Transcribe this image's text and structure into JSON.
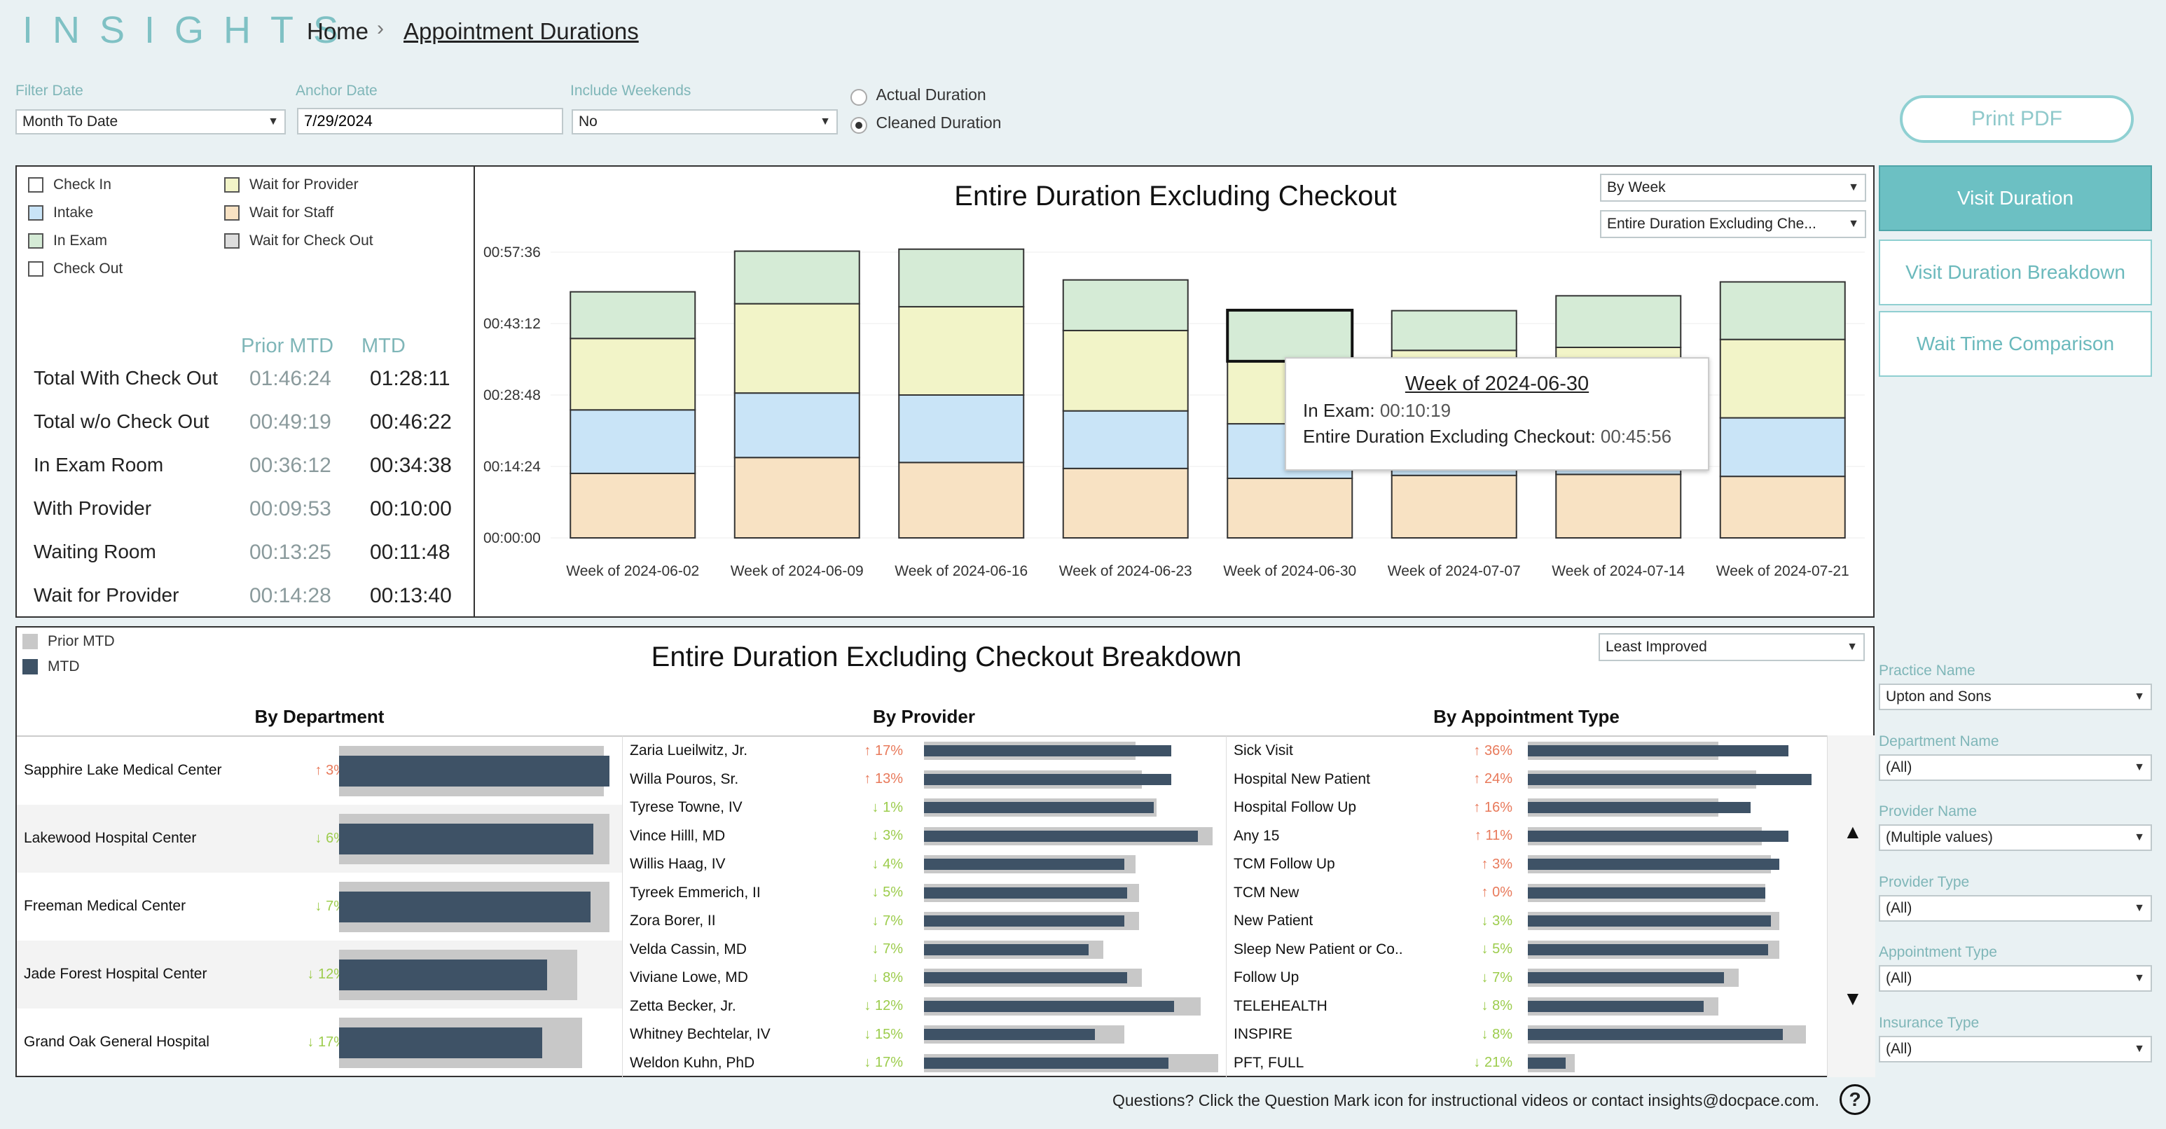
{
  "header": {
    "logo": "INSIGHTS",
    "breadcrumb": {
      "home": "Home",
      "separator": "›",
      "current": "Appointment Durations"
    }
  },
  "filters": {
    "filter_date": {
      "label": "Filter Date",
      "value": "Month To Date"
    },
    "anchor_date": {
      "label": "Anchor Date",
      "value": "7/29/2024"
    },
    "include_weekends": {
      "label": "Include Weekends",
      "value": "No"
    },
    "duration_mode": {
      "options": [
        "Actual Duration",
        "Cleaned Duration"
      ],
      "selected": "Cleaned Duration"
    }
  },
  "buttons": {
    "print": "Print PDF",
    "nav": [
      "Visit Duration",
      "Visit Duration Breakdown",
      "Wait Time Comparison"
    ],
    "active_nav": "Visit Duration"
  },
  "legend": {
    "items": [
      {
        "label": "Check In",
        "color": "#ffffff"
      },
      {
        "label": "Wait for Provider",
        "color": "#f2f4c8"
      },
      {
        "label": "Intake",
        "color": "#c9e4f7"
      },
      {
        "label": "Wait for Staff",
        "color": "#f8e2c3"
      },
      {
        "label": "In Exam",
        "color": "#d5ebd6"
      },
      {
        "label": "Wait for Check Out",
        "color": "#dddddd"
      },
      {
        "label": "Check Out",
        "color": "#ffffff"
      }
    ]
  },
  "stats": {
    "col_prior": "Prior MTD",
    "col_mtd": "MTD",
    "rows": [
      {
        "label": "Total With Check Out",
        "prior": "01:46:24",
        "mtd": "01:28:11"
      },
      {
        "label": "Total w/o Check Out",
        "prior": "00:49:19",
        "mtd": "00:46:22"
      },
      {
        "label": "In Exam Room",
        "prior": "00:36:12",
        "mtd": "00:34:38"
      },
      {
        "label": "With Provider",
        "prior": "00:09:53",
        "mtd": "00:10:00"
      },
      {
        "label": "Waiting Room",
        "prior": "00:13:25",
        "mtd": "00:11:48"
      },
      {
        "label": "Wait for Provider",
        "prior": "00:14:28",
        "mtd": "00:13:40"
      }
    ]
  },
  "main_chart": {
    "title": "Entire Duration Excluding Checkout",
    "granularity": "By Week",
    "measure": "Entire Duration Excluding Che...",
    "tooltip": {
      "title": "Week of 2024-06-30",
      "line1_label": "In Exam:",
      "line1_value": "00:10:19",
      "line2_label": "Entire Duration Excluding Checkout:",
      "line2_value": "00:45:56"
    }
  },
  "breakdown": {
    "title": "Entire Duration Excluding Checkout Breakdown",
    "sort": "Least Improved",
    "legend": [
      {
        "label": "Prior MTD",
        "color": "#c8c8c8"
      },
      {
        "label": "MTD",
        "color": "#3e5266"
      }
    ],
    "by_department": {
      "title": "By Department",
      "rows": [
        {
          "name": "Sapphire Lake Medical Center",
          "pct": "↑ 3%",
          "dir": "up",
          "prior": 0.98,
          "mtd": 1.0
        },
        {
          "name": "Lakewood Hospital Center",
          "pct": "↓ 6%",
          "dir": "down",
          "prior": 1.0,
          "mtd": 0.94
        },
        {
          "name": "Freeman Medical Center",
          "pct": "↓ 7%",
          "dir": "down",
          "prior": 1.0,
          "mtd": 0.93
        },
        {
          "name": "Jade Forest Hospital Center",
          "pct": "↓ 12%",
          "dir": "down",
          "prior": 0.88,
          "mtd": 0.77
        },
        {
          "name": "Grand Oak General Hospital",
          "pct": "↓ 17%",
          "dir": "down",
          "prior": 0.9,
          "mtd": 0.75
        }
      ]
    },
    "by_provider": {
      "title": "By Provider",
      "rows": [
        {
          "name": "Zaria Lueilwitz, Jr.",
          "pct": "↑ 17%",
          "dir": "up",
          "prior": 0.72,
          "mtd": 0.84
        },
        {
          "name": "Willa Pouros, Sr.",
          "pct": "↑ 13%",
          "dir": "up",
          "prior": 0.74,
          "mtd": 0.84
        },
        {
          "name": "Tyrese Towne, IV",
          "pct": "↓ 1%",
          "dir": "down",
          "prior": 0.79,
          "mtd": 0.78
        },
        {
          "name": "Vince Hilll, MD",
          "pct": "↓ 3%",
          "dir": "down",
          "prior": 0.98,
          "mtd": 0.93
        },
        {
          "name": "Willis Haag, IV",
          "pct": "↓ 4%",
          "dir": "down",
          "prior": 0.72,
          "mtd": 0.68
        },
        {
          "name": "Tyreek Emmerich, II",
          "pct": "↓ 5%",
          "dir": "down",
          "prior": 0.73,
          "mtd": 0.69
        },
        {
          "name": "Zora Borer, II",
          "pct": "↓ 7%",
          "dir": "down",
          "prior": 0.73,
          "mtd": 0.68
        },
        {
          "name": "Velda Cassin, MD",
          "pct": "↓ 7%",
          "dir": "down",
          "prior": 0.61,
          "mtd": 0.56
        },
        {
          "name": "Viviane Lowe, MD",
          "pct": "↓ 8%",
          "dir": "down",
          "prior": 0.74,
          "mtd": 0.69
        },
        {
          "name": "Zetta Becker, Jr.",
          "pct": "↓ 12%",
          "dir": "down",
          "prior": 0.94,
          "mtd": 0.85
        },
        {
          "name": "Whitney Bechtelar, IV",
          "pct": "↓ 15%",
          "dir": "down",
          "prior": 0.68,
          "mtd": 0.58
        },
        {
          "name": "Weldon Kuhn, PhD",
          "pct": "↓ 17%",
          "dir": "down",
          "prior": 1.0,
          "mtd": 0.83
        }
      ]
    },
    "by_appointment_type": {
      "title": "By Appointment Type",
      "rows": [
        {
          "name": "Sick Visit",
          "pct": "↑ 36%",
          "dir": "up",
          "prior": 0.65,
          "mtd": 0.89
        },
        {
          "name": "Hospital New Patient",
          "pct": "↑ 24%",
          "dir": "up",
          "prior": 0.78,
          "mtd": 0.97
        },
        {
          "name": "Hospital Follow Up",
          "pct": "↑ 16%",
          "dir": "up",
          "prior": 0.65,
          "mtd": 0.76
        },
        {
          "name": "Any 15",
          "pct": "↑ 11%",
          "dir": "up",
          "prior": 0.8,
          "mtd": 0.89
        },
        {
          "name": "TCM Follow Up",
          "pct": "↑ 3%",
          "dir": "up",
          "prior": 0.83,
          "mtd": 0.86
        },
        {
          "name": "TCM New",
          "pct": "↑ 0%",
          "dir": "up",
          "prior": 0.81,
          "mtd": 0.81
        },
        {
          "name": "New Patient",
          "pct": "↓ 3%",
          "dir": "down",
          "prior": 0.86,
          "mtd": 0.83
        },
        {
          "name": "Sleep New Patient or Co..",
          "pct": "↓ 5%",
          "dir": "down",
          "prior": 0.86,
          "mtd": 0.82
        },
        {
          "name": "Follow Up",
          "pct": "↓ 7%",
          "dir": "down",
          "prior": 0.72,
          "mtd": 0.67
        },
        {
          "name": "TELEHEALTH",
          "pct": "↓ 8%",
          "dir": "down",
          "prior": 0.65,
          "mtd": 0.6
        },
        {
          "name": "INSPIRE",
          "pct": "↓ 8%",
          "dir": "down",
          "prior": 0.95,
          "mtd": 0.87
        },
        {
          "name": "PFT, FULL",
          "pct": "↓ 21%",
          "dir": "down",
          "prior": 0.16,
          "mtd": 0.13
        }
      ]
    }
  },
  "sidebar_filters": [
    {
      "label": "Practice Name",
      "value": "Upton and Sons"
    },
    {
      "label": "Department Name",
      "value": "(All)"
    },
    {
      "label": "Provider Name",
      "value": "(Multiple values)"
    },
    {
      "label": "Provider Type",
      "value": "(All)"
    },
    {
      "label": "Appointment Type",
      "value": "(All)"
    },
    {
      "label": "Insurance Type",
      "value": "(All)"
    }
  ],
  "scroll": {
    "up": "▲",
    "down": "▼"
  },
  "footer": {
    "text": "Questions? Click the Question Mark icon for instructional videos or contact insights@docpace.com.",
    "help": "?"
  },
  "chart_data": {
    "type": "bar",
    "stacked": true,
    "title": "Entire Duration Excluding Checkout",
    "xlabel": "",
    "ylabel": "",
    "y_unit": "minutes",
    "y_ticks": [
      "00:00:00",
      "00:14:24",
      "00:28:48",
      "00:43:12",
      "00:57:36"
    ],
    "ylim": [
      0,
      57.6
    ],
    "categories": [
      "Week of 2024-06-02",
      "Week of 2024-06-09",
      "Week of 2024-06-16",
      "Week of 2024-06-23",
      "Week of 2024-06-30",
      "Week of 2024-07-07",
      "Week of 2024-07-14",
      "Week of 2024-07-21"
    ],
    "highlighted": "Week of 2024-06-30",
    "series": [
      {
        "name": "Wait for Staff",
        "color": "#f8e2c3",
        "values": [
          13.0,
          16.2,
          15.2,
          14.0,
          12.0,
          12.6,
          12.8,
          12.4
        ]
      },
      {
        "name": "Intake",
        "color": "#c9e4f7",
        "values": [
          12.8,
          13.0,
          13.6,
          11.6,
          11.0,
          12.2,
          12.0,
          11.8
        ]
      },
      {
        "name": "Wait for Provider",
        "color": "#f2f4c8",
        "values": [
          14.4,
          18.0,
          17.8,
          16.2,
          12.6,
          13.0,
          13.6,
          15.8
        ]
      },
      {
        "name": "In Exam",
        "color": "#d5ebd6",
        "values": [
          9.4,
          10.6,
          11.6,
          10.2,
          10.3,
          8.0,
          10.4,
          11.6
        ]
      }
    ]
  }
}
